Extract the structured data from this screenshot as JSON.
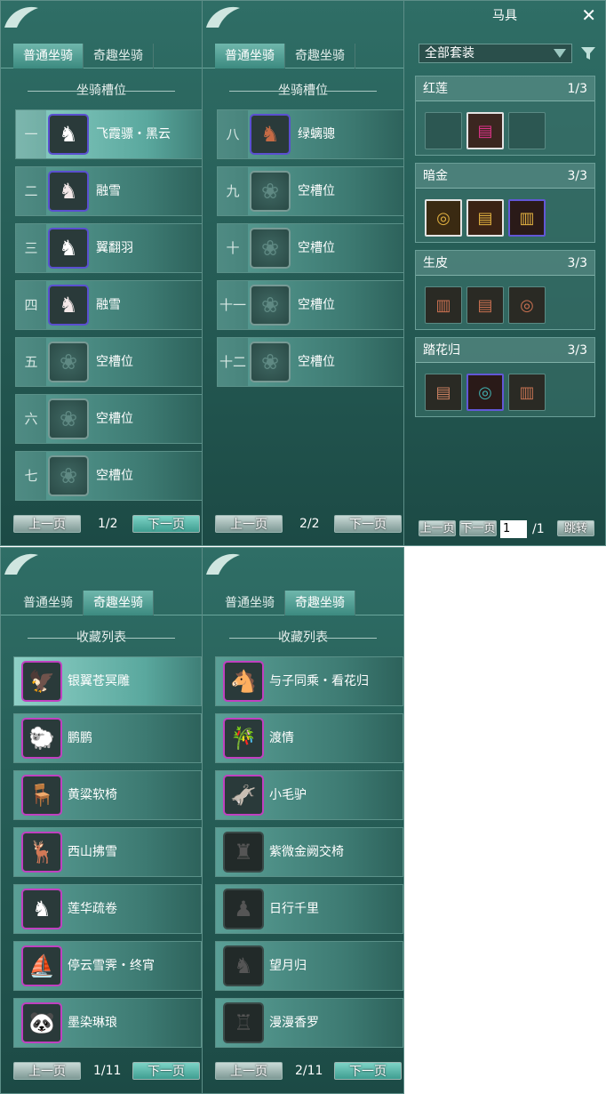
{
  "tabs": {
    "normal": "普通坐骑",
    "fun": "奇趣坐骑"
  },
  "panel1": {
    "section": "坐骑槽位",
    "slots": [
      {
        "num": "一",
        "name": "飞霞骠・黑云",
        "icon": "black-horse-icon"
      },
      {
        "num": "二",
        "name": "融雪",
        "icon": "white-horse-icon"
      },
      {
        "num": "三",
        "name": "翼翻羽",
        "icon": "black-horse-icon"
      },
      {
        "num": "四",
        "name": "融雪",
        "icon": "white-horse-icon"
      },
      {
        "num": "五",
        "name": "空槽位",
        "icon": "empty-slot-icon"
      },
      {
        "num": "六",
        "name": "空槽位",
        "icon": "empty-slot-icon"
      },
      {
        "num": "七",
        "name": "空槽位",
        "icon": "empty-slot-icon"
      }
    ],
    "prev": "上一页",
    "next": "下一页",
    "page": "1/2"
  },
  "panel2": {
    "section": "坐骑槽位",
    "slots": [
      {
        "num": "八",
        "name": "绿螭骢",
        "icon": "brown-horse-icon"
      },
      {
        "num": "九",
        "name": "空槽位",
        "icon": "empty-slot-icon"
      },
      {
        "num": "十",
        "name": "空槽位",
        "icon": "empty-slot-icon"
      },
      {
        "num": "十一",
        "name": "空槽位",
        "icon": "empty-slot-icon"
      },
      {
        "num": "十二",
        "name": "空槽位",
        "icon": "empty-slot-icon"
      }
    ],
    "prev": "上一页",
    "next": "下一页",
    "page": "2/2"
  },
  "gear": {
    "title": "马具",
    "filter": "全部套装",
    "sets": [
      {
        "name": "红莲",
        "count": "1/3"
      },
      {
        "name": "暗金",
        "count": "3/3"
      },
      {
        "name": "生皮",
        "count": "3/3"
      },
      {
        "name": "踏花归",
        "count": "3/3"
      }
    ],
    "prev": "上一页",
    "next": "下一页",
    "page_input": "1",
    "page_total": "/1",
    "jump": "跳转"
  },
  "panel3": {
    "section": "收藏列表",
    "items": [
      {
        "name": "银翼苍冥雕",
        "icon": "eagle-icon"
      },
      {
        "name": "鹏鹏",
        "icon": "sheep-icon"
      },
      {
        "name": "黄粱软椅",
        "icon": "chair-icon"
      },
      {
        "name": "西山拂雪",
        "icon": "white-deer-icon"
      },
      {
        "name": "莲华疏卷",
        "icon": "white-horse-icon"
      },
      {
        "name": "停云雪霁・终宵",
        "icon": "boat-icon"
      },
      {
        "name": "墨染琳琅",
        "icon": "panda-icon"
      }
    ],
    "prev": "上一页",
    "next": "下一页",
    "page": "1/11"
  },
  "panel4": {
    "section": "收藏列表",
    "items": [
      {
        "name": "与子同乘・看花归",
        "icon": "riders-icon"
      },
      {
        "name": "渡情",
        "icon": "raft-icon"
      },
      {
        "name": "小毛驴",
        "icon": "donkey-icon"
      },
      {
        "name": "紫微金阙交椅",
        "icon": "throne-icon"
      },
      {
        "name": "日行千里",
        "icon": "beast-icon"
      },
      {
        "name": "望月归",
        "icon": "deer-icon"
      },
      {
        "name": "漫漫香罗",
        "icon": "cart-icon"
      }
    ],
    "prev": "上一页",
    "next": "下一页",
    "page": "2/11"
  }
}
